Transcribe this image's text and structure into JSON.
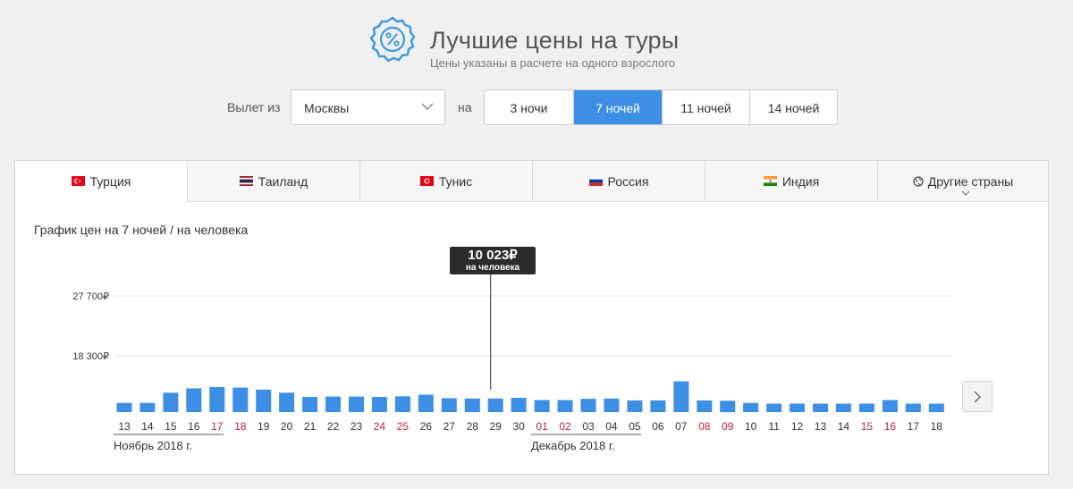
{
  "header": {
    "title": "Лучшие цены на туры",
    "subtitle": "Цены указаны в расчете на одного взрослого",
    "logo_icon": "percent-badge-icon"
  },
  "controls": {
    "departure_label": "Вылет из",
    "departure_value": "Москвы",
    "on_label": "на",
    "nights": [
      "3 ночи",
      "7 ночей",
      "11 ночей",
      "14 ночей"
    ],
    "active_nights": "7 ночей"
  },
  "tabs": [
    {
      "label": "Турция",
      "icon": "turkey-flag-icon",
      "active": true
    },
    {
      "label": "Таиланд",
      "icon": "thailand-flag-icon",
      "active": false
    },
    {
      "label": "Тунис",
      "icon": "tunisia-flag-icon",
      "active": false
    },
    {
      "label": "Россия",
      "icon": "russia-flag-icon",
      "active": false
    },
    {
      "label": "Индия",
      "icon": "india-flag-icon",
      "active": false
    },
    {
      "label": "Другие страны",
      "icon": "globe-icon",
      "active": false
    }
  ],
  "chart_title": "График цен на 7 ночей / на человека",
  "tooltip": {
    "price": "10 023₽",
    "per": "на человека"
  },
  "colors": {
    "accent": "#3d8fe5",
    "bar": "#3d8fe5",
    "weekend": "#c0233c",
    "text": "#333333"
  },
  "chart_data": {
    "type": "bar",
    "y_ticks": [
      "27 700₽",
      "18 300₽"
    ],
    "y_tick_values": [
      27700,
      18300
    ],
    "ylim": [
      8550,
      27700
    ],
    "categories": [
      "13",
      "14",
      "15",
      "16",
      "17",
      "18",
      "19",
      "20",
      "21",
      "22",
      "23",
      "24",
      "25",
      "26",
      "27",
      "28",
      "29",
      "30",
      "01",
      "02",
      "03",
      "04",
      "05",
      "06",
      "07",
      "08",
      "09",
      "10",
      "11",
      "12",
      "13",
      "14",
      "15",
      "16",
      "17",
      "18"
    ],
    "weekend": [
      false,
      false,
      false,
      false,
      true,
      true,
      false,
      false,
      false,
      false,
      false,
      true,
      true,
      false,
      false,
      false,
      false,
      false,
      true,
      true,
      false,
      false,
      false,
      false,
      false,
      true,
      true,
      false,
      false,
      false,
      false,
      false,
      true,
      true,
      false,
      false
    ],
    "values": [
      10900,
      10900,
      12500,
      13200,
      13400,
      13300,
      13000,
      12500,
      11850,
      11900,
      11900,
      11850,
      11950,
      12200,
      11650,
      11600,
      11600,
      11700,
      11350,
      11350,
      11550,
      11600,
      11300,
      11300,
      14300,
      11300,
      11250,
      10900,
      10800,
      10800,
      10800,
      10800,
      10800,
      11350,
      10800,
      10800
    ],
    "months": [
      "Ноябрь 2018 г.",
      "Декабрь 2018 г."
    ],
    "selected_index": 16,
    "selected_value": 10023
  },
  "next_button_icon": "chevron-right-icon"
}
